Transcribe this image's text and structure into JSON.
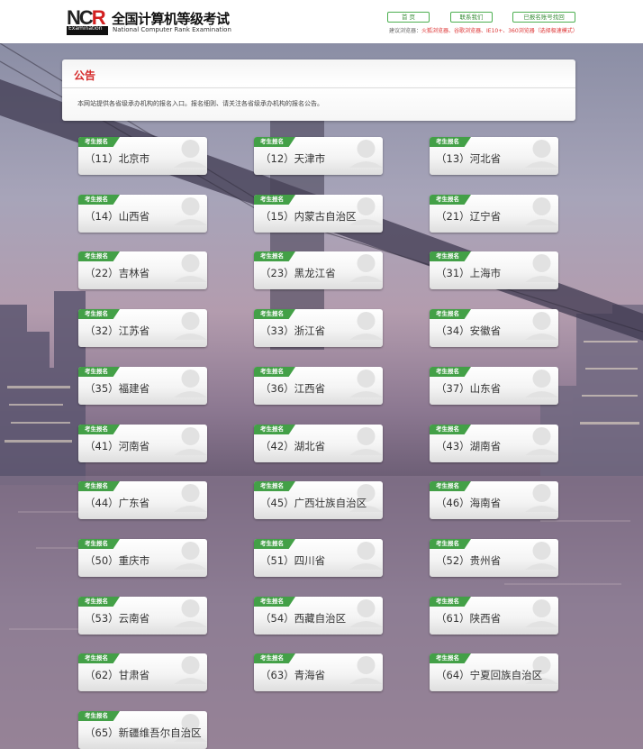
{
  "header": {
    "logo_mark_left": "NC",
    "logo_mark_right": "R",
    "logo_band_text": "Examination",
    "title": "全国计算机等级考试",
    "subtitle": "National Computer Rank Examination",
    "buttons": [
      "首 页",
      "联系我们",
      "已报名账号找回"
    ],
    "browser_tip_prefix": "建议浏览器：",
    "browser_tip_highlight": "火狐浏览器、谷歌浏览器、IE10+、360浏览器（选择极速模式）"
  },
  "notice": {
    "title": "公告",
    "text": "本网站提供各省级承办机构的报名入口。报名细则、请关注各省级承办机构的报名公告。"
  },
  "card_badge": "考生报名",
  "provinces": [
    "（11）北京市",
    "（12）天津市",
    "（13）河北省",
    "（14）山西省",
    "（15）内蒙古自治区",
    "（21）辽宁省",
    "（22）吉林省",
    "（23）黑龙江省",
    "（31）上海市",
    "（32）江苏省",
    "（33）浙江省",
    "（34）安徽省",
    "（35）福建省",
    "（36）江西省",
    "（37）山东省",
    "（41）河南省",
    "（42）湖北省",
    "（43）湖南省",
    "（44）广东省",
    "（45）广西壮族自治区",
    "（46）海南省",
    "（50）重庆市",
    "（51）四川省",
    "（52）贵州省",
    "（53）云南省",
    "（54）西藏自治区",
    "（61）陕西省",
    "（62）甘肃省",
    "（63）青海省",
    "（64）宁夏回族自治区",
    "（65）新疆维吾尔自治区"
  ],
  "colors": {
    "accent_green": "#43a047",
    "notice_red": "#d52a2a",
    "logo_red": "#d21f1f"
  }
}
